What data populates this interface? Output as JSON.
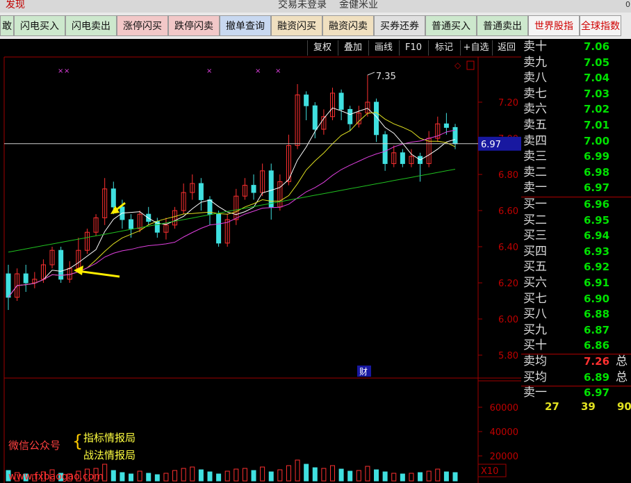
{
  "topbar": {
    "left": "发现",
    "status": "交易未登录",
    "stock": "金健米业",
    "corner": "0"
  },
  "trade_buttons": [
    "敢",
    "闪电买入",
    "闪电卖出",
    "涨停闪买",
    "跌停闪卖",
    "撤单查询",
    "融资闪买",
    "融资闪卖",
    "买券还券",
    "普通买入",
    "普通卖出",
    "世界股指",
    "全球指数"
  ],
  "chart_toolbar": [
    "复权",
    "叠加",
    "画线",
    "F10",
    "标记",
    "+自选",
    "返回"
  ],
  "chart": {
    "price_label_high": "7.35",
    "current_price": "6.97",
    "y_ticks": [
      "7.20",
      "7.00",
      "6.80",
      "6.60",
      "6.40",
      "6.20",
      "6.00",
      "5.80"
    ],
    "caifu": "财",
    "vol_ticks": [
      "60000",
      "40000",
      "20000"
    ],
    "vol_unit": "X10",
    "watermark": "www.fxbaogao.com"
  },
  "chart_data": {
    "type": "candlestick",
    "ylim": [
      5.78,
      7.35
    ],
    "candles": [
      [
        6.25,
        6.12,
        6.3,
        6.05
      ],
      [
        6.12,
        6.25,
        6.28,
        6.1
      ],
      [
        6.25,
        6.2,
        6.3,
        6.15
      ],
      [
        6.2,
        6.22,
        6.26,
        6.17
      ],
      [
        6.22,
        6.3,
        6.33,
        6.2
      ],
      [
        6.3,
        6.38,
        6.4,
        6.28
      ],
      [
        6.38,
        6.22,
        6.4,
        6.2
      ],
      [
        6.22,
        6.28,
        6.32,
        6.2
      ],
      [
        6.28,
        6.38,
        6.45,
        6.26
      ],
      [
        6.38,
        6.48,
        6.5,
        6.36
      ],
      [
        6.48,
        6.56,
        6.58,
        6.46
      ],
      [
        6.56,
        6.72,
        6.78,
        6.52
      ],
      [
        6.72,
        6.62,
        6.76,
        6.58
      ],
      [
        6.62,
        6.55,
        6.66,
        6.5
      ],
      [
        6.55,
        6.5,
        6.58,
        6.45
      ],
      [
        6.5,
        6.58,
        6.6,
        6.48
      ],
      [
        6.58,
        6.54,
        6.62,
        6.52
      ],
      [
        6.54,
        6.48,
        6.56,
        6.45
      ],
      [
        6.48,
        6.52,
        6.56,
        6.44
      ],
      [
        6.52,
        6.6,
        6.62,
        6.5
      ],
      [
        6.6,
        6.7,
        6.75,
        6.58
      ],
      [
        6.7,
        6.75,
        6.8,
        6.66
      ],
      [
        6.75,
        6.66,
        6.78,
        6.6
      ],
      [
        6.66,
        6.58,
        6.68,
        6.52
      ],
      [
        6.58,
        6.42,
        6.6,
        6.4
      ],
      [
        6.42,
        6.55,
        6.58,
        6.4
      ],
      [
        6.55,
        6.68,
        6.72,
        6.52
      ],
      [
        6.68,
        6.74,
        6.78,
        6.66
      ],
      [
        6.74,
        6.7,
        6.8,
        6.66
      ],
      [
        6.7,
        6.82,
        6.86,
        6.68
      ],
      [
        6.82,
        6.62,
        6.86,
        6.55
      ],
      [
        6.62,
        6.76,
        6.8,
        6.6
      ],
      [
        6.76,
        6.96,
        7.02,
        6.74
      ],
      [
        6.96,
        7.24,
        7.3,
        6.94
      ],
      [
        7.24,
        7.18,
        7.26,
        7.1
      ],
      [
        7.18,
        7.05,
        7.2,
        7.0
      ],
      [
        7.05,
        7.12,
        7.16,
        7.02
      ],
      [
        7.12,
        7.25,
        7.28,
        7.1
      ],
      [
        7.25,
        7.16,
        7.27,
        7.1
      ],
      [
        7.16,
        7.08,
        7.18,
        7.04
      ],
      [
        7.08,
        7.14,
        7.18,
        7.06
      ],
      [
        7.14,
        7.2,
        7.35,
        7.12
      ],
      [
        7.2,
        7.02,
        7.22,
        6.98
      ],
      [
        7.02,
        6.86,
        7.04,
        6.82
      ],
      [
        6.86,
        6.92,
        6.96,
        6.84
      ],
      [
        6.92,
        6.86,
        6.94,
        6.84
      ],
      [
        6.86,
        6.9,
        6.94,
        6.84
      ],
      [
        6.9,
        6.86,
        6.92,
        6.76
      ],
      [
        6.86,
        7.0,
        7.04,
        6.84
      ],
      [
        7.0,
        7.08,
        7.12,
        6.98
      ],
      [
        7.08,
        7.06,
        7.14,
        7.02
      ],
      [
        7.06,
        6.97,
        7.08,
        6.94
      ]
    ],
    "volumes": [
      15,
      12,
      10,
      9,
      13,
      16,
      11,
      10,
      14,
      17,
      18,
      24,
      15,
      12,
      10,
      14,
      11,
      9,
      11,
      15,
      18,
      20,
      16,
      13,
      10,
      14,
      17,
      18,
      15,
      20,
      13,
      16,
      22,
      30,
      24,
      19,
      18,
      22,
      17,
      14,
      15,
      21,
      16,
      13,
      11,
      10,
      11,
      12,
      14,
      17,
      13,
      12
    ]
  },
  "orderbook": {
    "sell": [
      [
        "卖十",
        "7.06"
      ],
      [
        "卖九",
        "7.05"
      ],
      [
        "卖八",
        "7.04"
      ],
      [
        "卖七",
        "7.03"
      ],
      [
        "卖六",
        "7.02"
      ],
      [
        "卖五",
        "7.01"
      ],
      [
        "卖四",
        "7.00"
      ],
      [
        "卖三",
        "6.99"
      ],
      [
        "卖二",
        "6.98"
      ],
      [
        "卖一",
        "6.97"
      ]
    ],
    "buy": [
      [
        "买一",
        "6.96"
      ],
      [
        "买二",
        "6.95"
      ],
      [
        "买三",
        "6.94"
      ],
      [
        "买四",
        "6.93"
      ],
      [
        "买五",
        "6.92"
      ],
      [
        "买六",
        "6.91"
      ],
      [
        "买七",
        "6.90"
      ],
      [
        "买八",
        "6.88"
      ],
      [
        "买九",
        "6.87"
      ],
      [
        "买十",
        "6.86"
      ]
    ],
    "avg_sell_label": "卖均",
    "avg_sell": "7.26",
    "avg_sell_suffix": "总",
    "avg_buy_label": "买均",
    "avg_buy": "6.89",
    "avg_buy_suffix": "总",
    "last_label": "卖一",
    "last_price": "6.97",
    "bottom_nums": [
      "27",
      "39",
      "90"
    ]
  },
  "annotations": {
    "wechat": "微信公众号",
    "brace": "{",
    "line1": "指标情报局",
    "line2": "战法情报局"
  },
  "colors": {
    "up": "#ff3030",
    "down": "#40e0e0",
    "ma5": "#ffffff",
    "ma10": "#e0e020",
    "ma20": "#e040e0",
    "ma60": "#20c020"
  }
}
